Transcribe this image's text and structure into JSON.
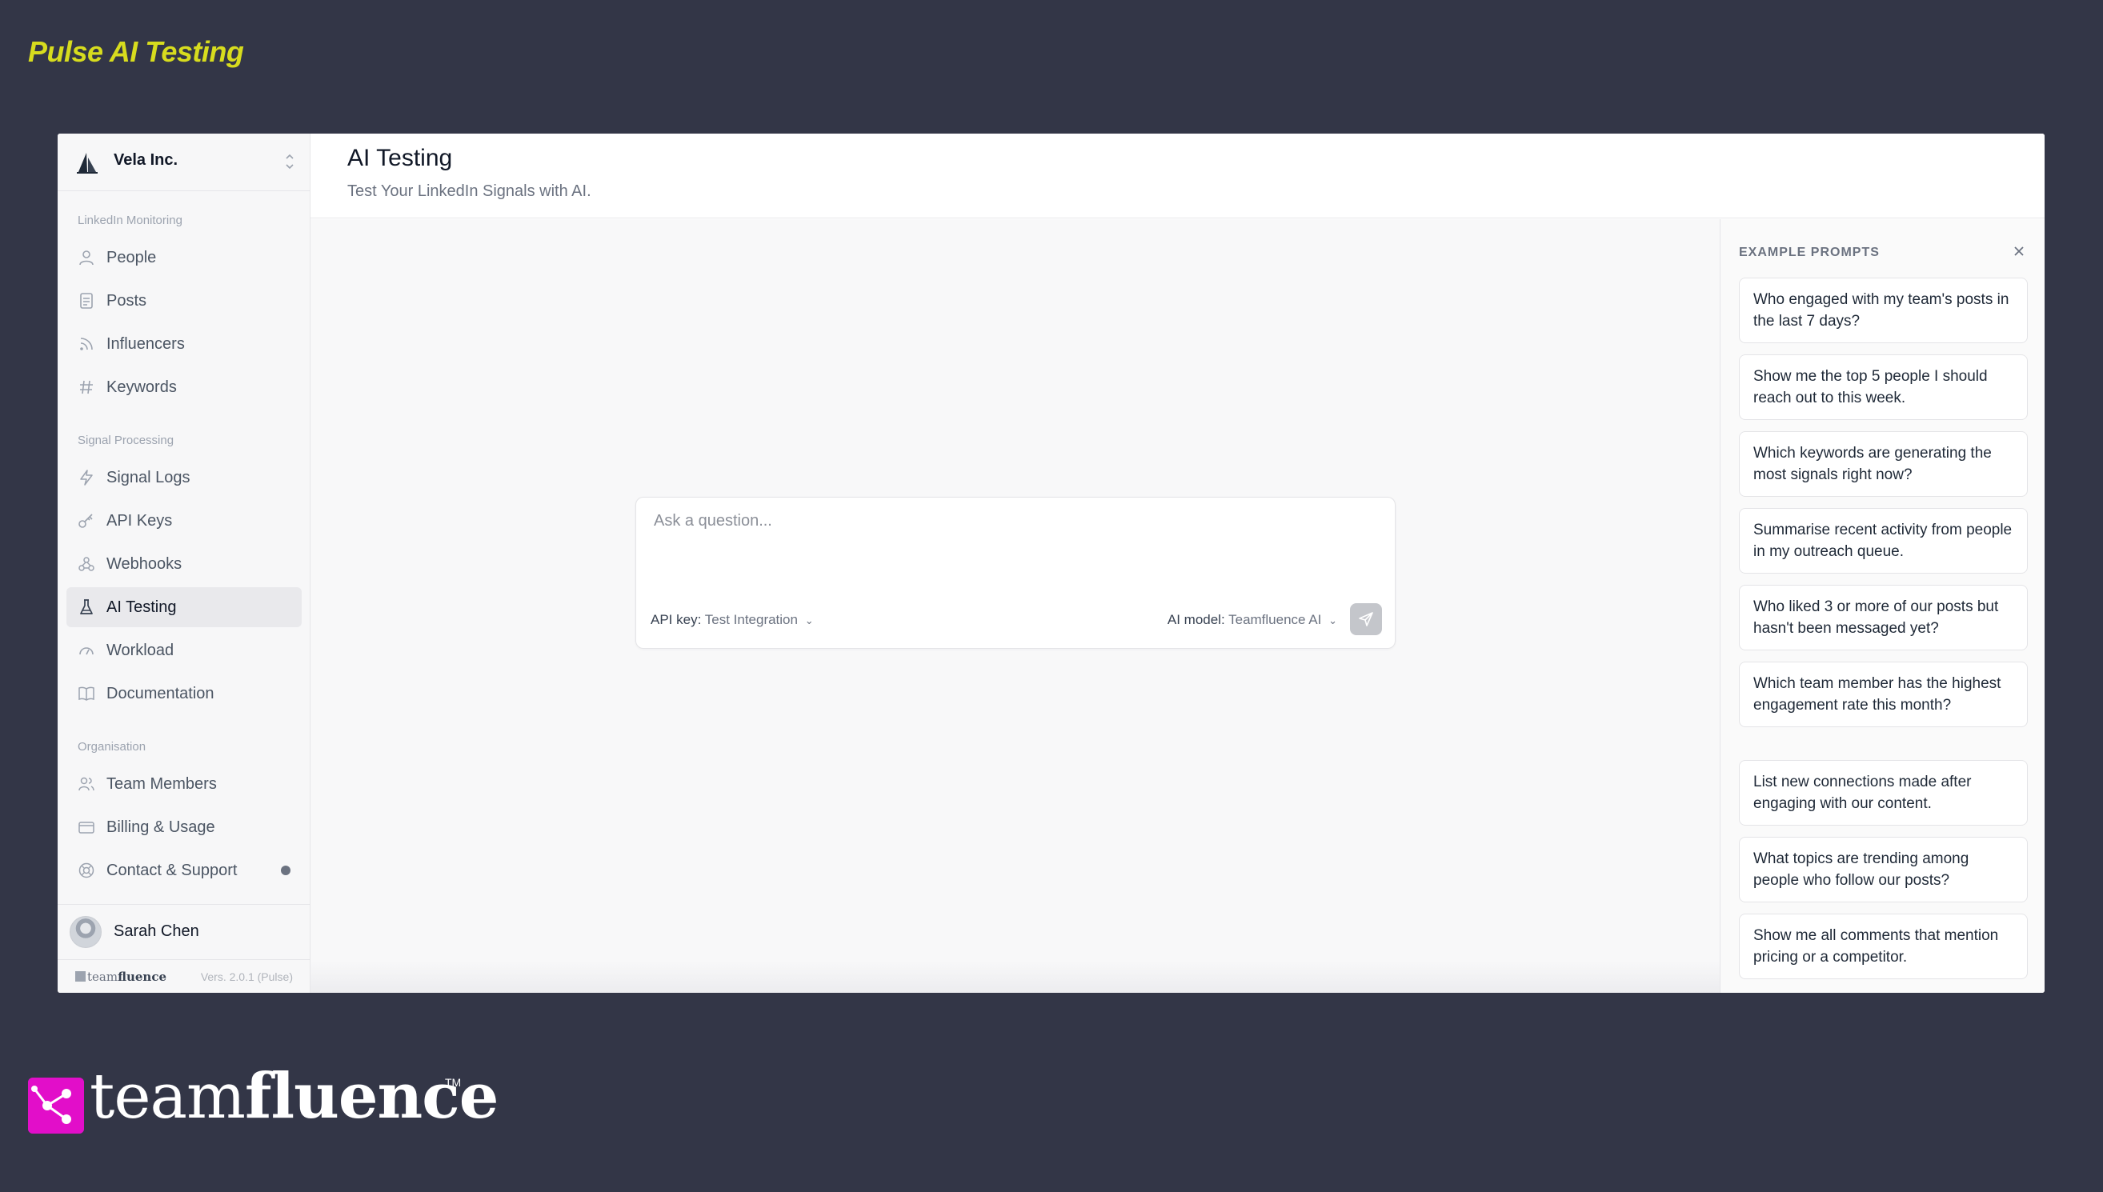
{
  "page_heading": "Pulse AI Testing",
  "sidebar": {
    "org_name": "Vela Inc.",
    "sections": [
      {
        "title": "LinkedIn Monitoring"
      },
      {
        "title": "Signal Processing"
      },
      {
        "title": "Organisation"
      }
    ],
    "items": [
      {
        "label": "People",
        "icon": "person-icon"
      },
      {
        "label": "Posts",
        "icon": "document-icon"
      },
      {
        "label": "Influencers",
        "icon": "rss-icon"
      },
      {
        "label": "Keywords",
        "icon": "hash-icon"
      },
      {
        "label": "Signal Logs",
        "icon": "lightning-icon"
      },
      {
        "label": "API Keys",
        "icon": "key-icon"
      },
      {
        "label": "Webhooks",
        "icon": "webhook-icon"
      },
      {
        "label": "AI Testing",
        "icon": "flask-icon",
        "active": true
      },
      {
        "label": "Workload",
        "icon": "gauge-icon"
      },
      {
        "label": "Documentation",
        "icon": "book-icon"
      },
      {
        "label": "Team Members",
        "icon": "users-icon"
      },
      {
        "label": "Billing & Usage",
        "icon": "credit-card-icon"
      },
      {
        "label": "Contact & Support",
        "icon": "lifebuoy-icon"
      }
    ],
    "user_name": "Sarah Chen",
    "footer_brand_light": "team",
    "footer_brand_bold": "fluence",
    "version": "Vers. 2.0.1 (Pulse)"
  },
  "main": {
    "title": "AI Testing",
    "subtitle": "Test Your LinkedIn Signals with AI.",
    "chat": {
      "placeholder": "Ask a question...",
      "api_key_label": "API key:",
      "api_key_value": "Test Integration",
      "ai_model_label": "AI model:",
      "ai_model_value": "Teamfluence AI"
    }
  },
  "prompts": {
    "title": "EXAMPLE PROMPTS",
    "items": [
      "Who engaged with my team's posts in the last 7 days?",
      "Show me the top 5 people I should reach out to this week.",
      "Which keywords are generating the most signals right now?",
      "Summarise recent activity from people in my outreach queue.",
      "Who liked 3 or more of our posts but hasn't been messaged yet?",
      "Which team member has the highest engagement rate this month?",
      "List new connections made after engaging with our content.",
      "What topics are trending among people who follow our posts?",
      "Show me all comments that mention pricing or a competitor."
    ]
  },
  "brand": {
    "light": "team",
    "bold": "fluence",
    "tm": "TM",
    "color": "#e20ec9"
  },
  "colors": {
    "background": "#333647",
    "heading": "#d7dc1e"
  }
}
